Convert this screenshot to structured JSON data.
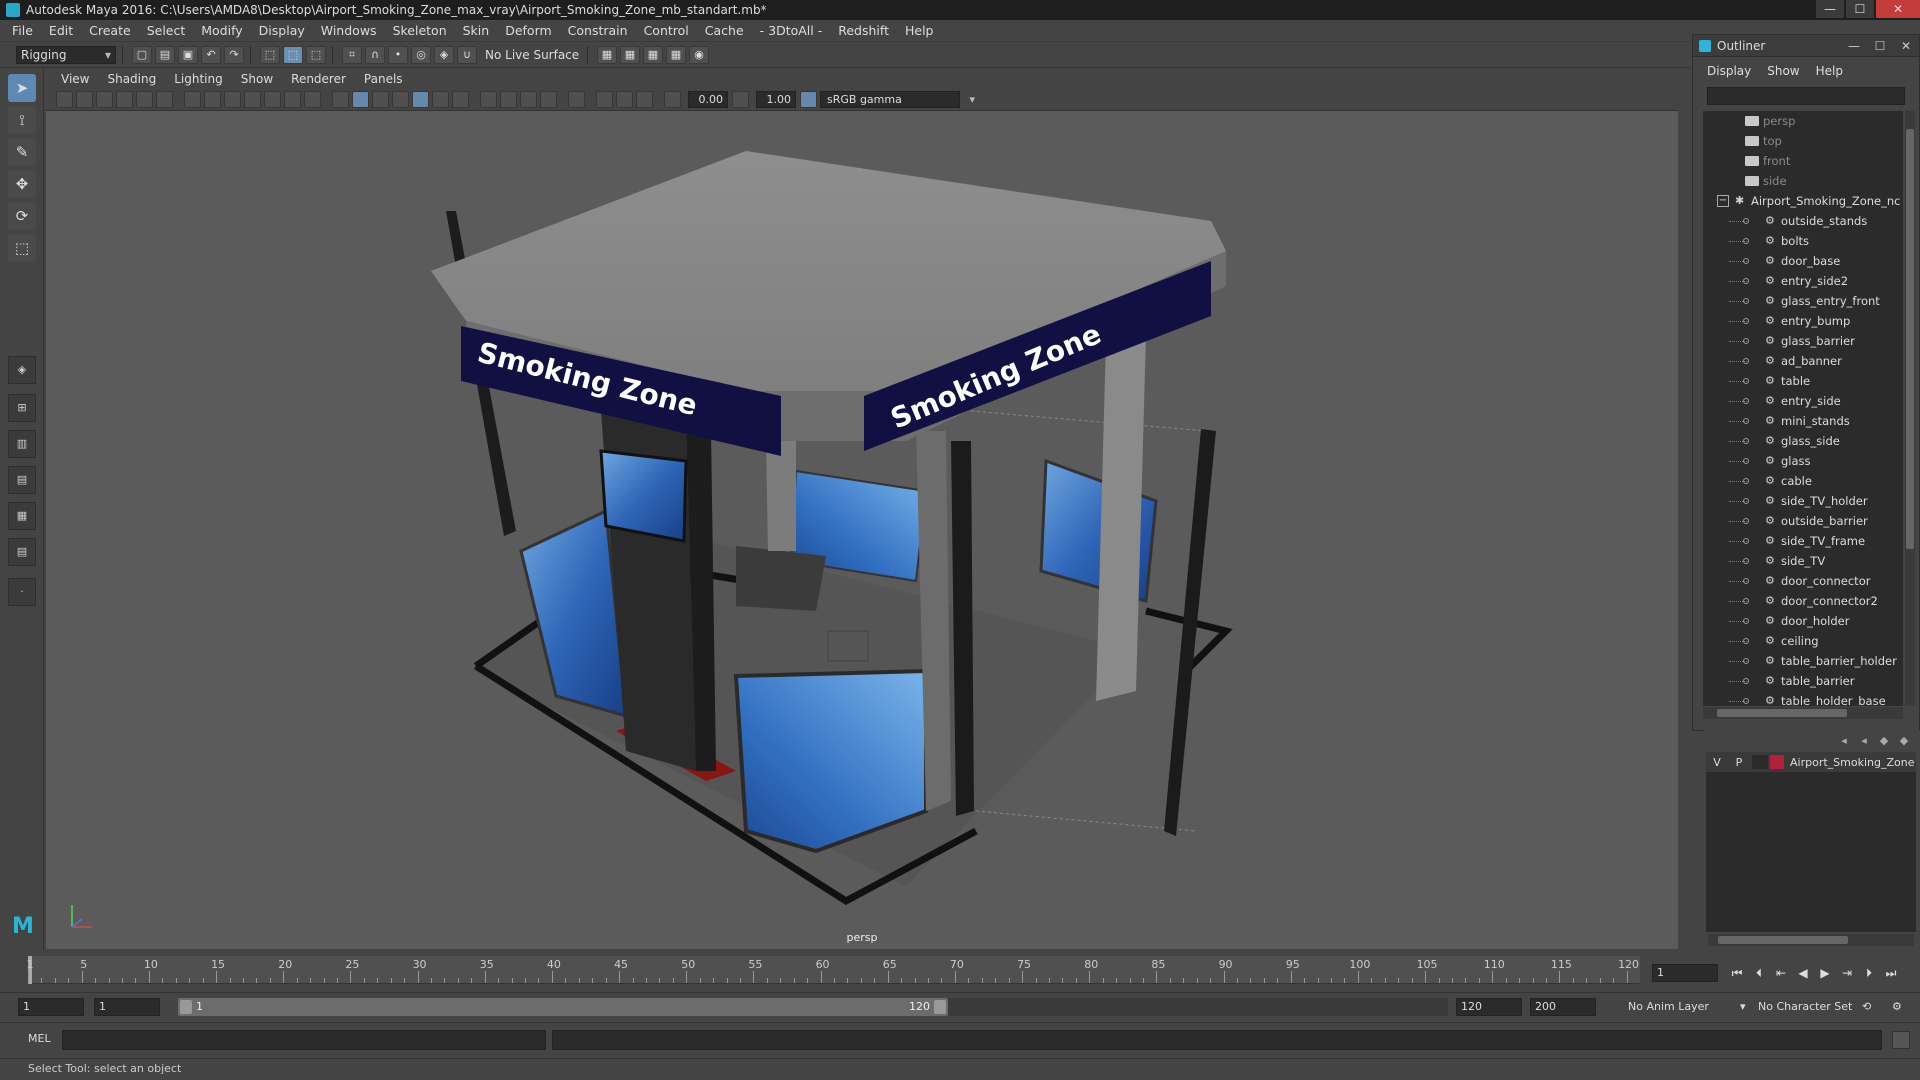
{
  "window": {
    "title": "Autodesk Maya 2016: C:\\Users\\AMDA8\\Desktop\\Airport_Smoking_Zone_max_vray\\Airport_Smoking_Zone_mb_standart.mb*",
    "min": "—",
    "max": "☐",
    "close": "✕"
  },
  "menubar": [
    "File",
    "Edit",
    "Create",
    "Select",
    "Modify",
    "Display",
    "Windows",
    "Skeleton",
    "Skin",
    "Deform",
    "Constrain",
    "Control",
    "Cache",
    "- 3DtoAll -",
    "Redshift",
    "Help"
  ],
  "statusline": {
    "mode": "Rigging",
    "live_surface": "No Live Surface"
  },
  "panel_menu": [
    "View",
    "Shading",
    "Lighting",
    "Show",
    "Renderer",
    "Panels"
  ],
  "panel_toolbar": {
    "exposure": "0.00",
    "gamma": "1.00",
    "color_space": "sRGB gamma"
  },
  "viewport": {
    "camera": "persp",
    "sign_text": "Smoking Zone"
  },
  "outliner": {
    "title": "Outliner",
    "menu": [
      "Display",
      "Show",
      "Help"
    ],
    "cameras": [
      "persp",
      "top",
      "front",
      "side"
    ],
    "root": "Airport_Smoking_Zone_nc",
    "children": [
      "outside_stands",
      "bolts",
      "door_base",
      "entry_side2",
      "glass_entry_front",
      "entry_bump",
      "glass_barrier",
      "ad_banner",
      "table",
      "entry_side",
      "mini_stands",
      "glass_side",
      "glass",
      "cable",
      "side_TV_holder",
      "outside_barrier",
      "side_TV_frame",
      "side_TV",
      "door_connector",
      "door_connector2",
      "door_holder",
      "ceiling",
      "table_barrier_holder",
      "table_barrier",
      "table_holder_base"
    ]
  },
  "layers": {
    "v": "V",
    "p": "P",
    "name": "Airport_Smoking_Zone",
    "color": "#b3203a"
  },
  "timeslider": {
    "labels": [
      "1",
      "5",
      "10",
      "15",
      "20",
      "25",
      "30",
      "35",
      "40",
      "45",
      "50",
      "55",
      "60",
      "65",
      "70",
      "75",
      "80",
      "85",
      "90",
      "95",
      "100",
      "105",
      "110",
      "115",
      "120"
    ],
    "current_frame": "1"
  },
  "rangebar": {
    "start": "1",
    "playback_start": "1",
    "slider_start": "1",
    "slider_end": "120",
    "playback_end": "120",
    "end": "200",
    "anim_layer": "No Anim Layer",
    "char_set": "No Character Set"
  },
  "cmdline": {
    "label": "MEL"
  },
  "helpline": {
    "text": "Select Tool: select an object"
  }
}
